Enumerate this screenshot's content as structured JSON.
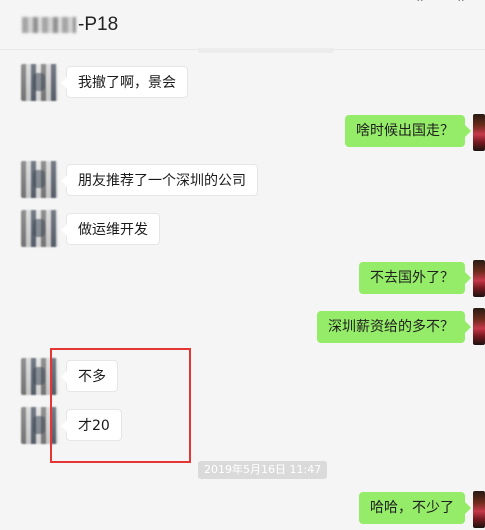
{
  "header": {
    "title": "-P18",
    "window_controls": [
      "pin-icon",
      "close-icon"
    ]
  },
  "messages": [
    {
      "side": "left",
      "text": "我撤了啊，景会"
    },
    {
      "side": "right",
      "text": "啥时候出国走？"
    },
    {
      "side": "left",
      "text": "朋友推荐了一个深圳的公司"
    },
    {
      "side": "left",
      "text": "做运维开发"
    },
    {
      "side": "right",
      "text": "不去国外了？"
    },
    {
      "side": "right",
      "text": "深圳薪资给的多不？"
    },
    {
      "side": "left",
      "text": "不多"
    },
    {
      "side": "left",
      "text": "才20"
    },
    {
      "side": "right",
      "text": "哈哈，不少了"
    }
  ],
  "timestamp": "2019年5月16日 11:47",
  "colors": {
    "background": "#f5f5f5",
    "bubble_self": "#95ec69",
    "bubble_other": "#ffffff",
    "annotation_box": "#e53535"
  }
}
